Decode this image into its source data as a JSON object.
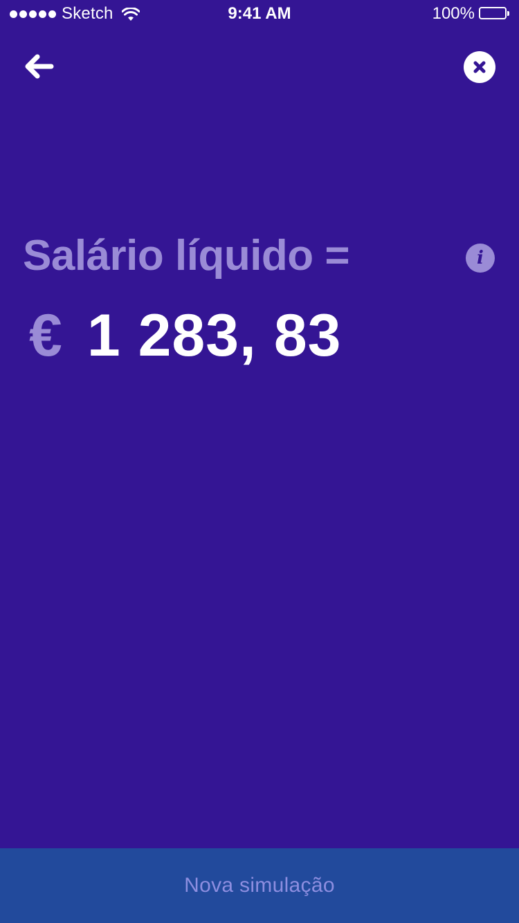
{
  "status_bar": {
    "carrier": "Sketch",
    "time": "9:41 AM",
    "battery_percent": "100%",
    "battery_level": 1.0
  },
  "nav": {
    "back_icon": "arrow-left-icon",
    "close_icon": "close-circle-icon"
  },
  "result": {
    "label": "Salário líquido =",
    "info_glyph": "i",
    "currency": "€",
    "amount": "1 283, 83"
  },
  "footer": {
    "button_label": "Nova simulação"
  },
  "colors": {
    "background": "#341594",
    "muted_text": "#9a8bd6",
    "button_background": "#224a9c",
    "button_text": "#8d8ee0",
    "white": "#ffffff"
  }
}
